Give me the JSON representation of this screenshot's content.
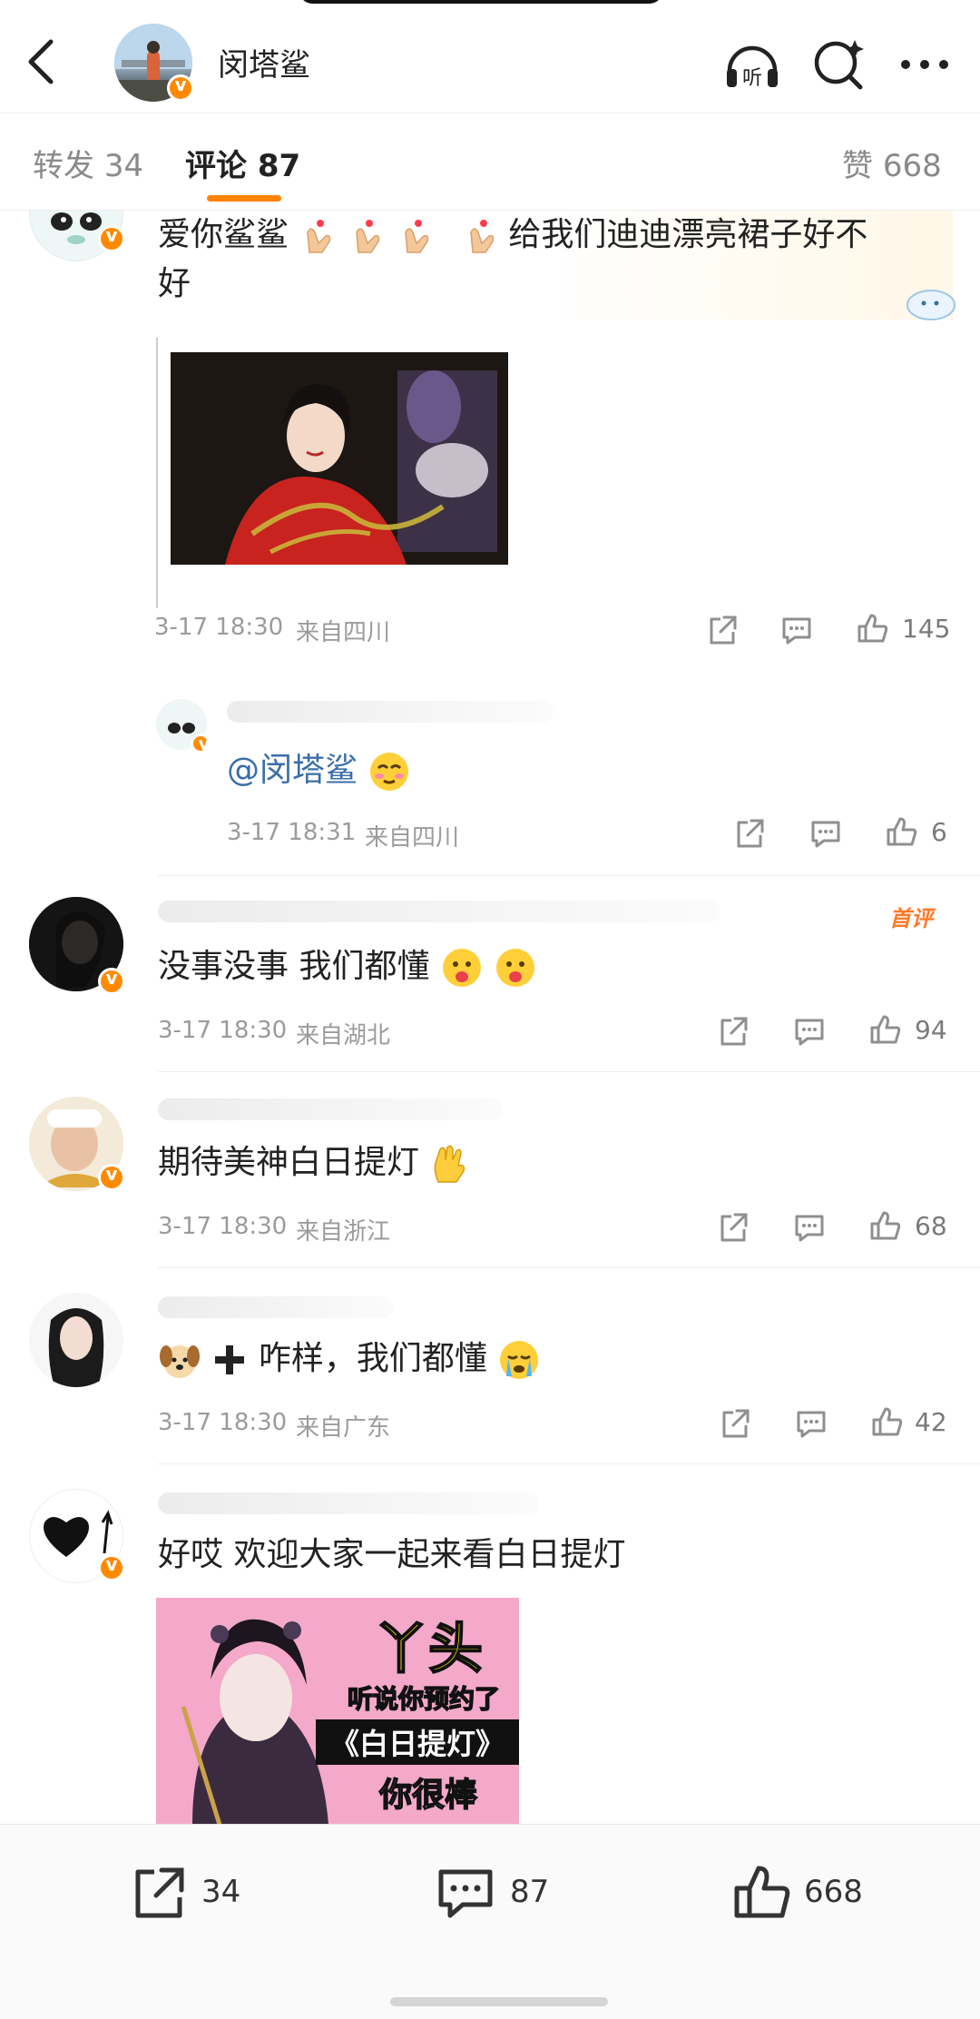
{
  "header": {
    "account_name": "闵塔鲨",
    "listen_label": "听"
  },
  "tabs": {
    "repost_label": "转发",
    "repost_count": "34",
    "comment_label": "评论",
    "comment_count": "87",
    "like_label": "赞",
    "like_count": "668"
  },
  "comments": [
    {
      "text": "爱你鲨鲨",
      "text_tail": "给我们迪迪漂亮裙子好不",
      "text_wrap": "好",
      "time": "3-17 18:30",
      "location": "来自四川",
      "likes": "145"
    },
    {
      "mention": "@闵塔鲨",
      "time": "3-17 18:31",
      "location": "来自四川",
      "likes": "6"
    },
    {
      "badge": "首评",
      "text": "没事没事 我们都懂",
      "time": "3-17 18:30",
      "location": "来自湖北",
      "likes": "94"
    },
    {
      "text": "期待美神白日提灯",
      "time": "3-17 18:30",
      "location": "来自浙江",
      "likes": "68"
    },
    {
      "text": "咋样，我们都懂",
      "time": "3-17 18:30",
      "location": "来自广东",
      "likes": "42"
    },
    {
      "text": "好哎 欢迎大家一起来看白日提灯",
      "image_title": "丫头",
      "image_line1": "听说你预约了",
      "image_line2": "《白日提灯》",
      "image_line3": "你很棒"
    }
  ],
  "bottom": {
    "repost_count": "34",
    "comment_count": "87",
    "like_count": "668"
  },
  "colors": {
    "accent": "#ff8200",
    "verified": "#ff8a00",
    "meta_gray": "#9b9b9b"
  },
  "icons": [
    "back-arrow-icon",
    "headphones-icon",
    "search-icon",
    "more-icon",
    "share-icon",
    "comment-icon",
    "like-icon"
  ]
}
